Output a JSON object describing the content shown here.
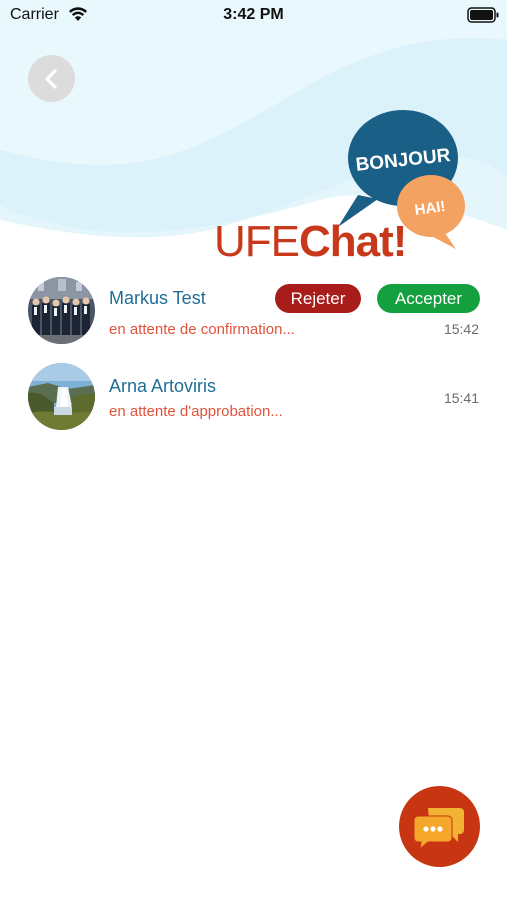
{
  "status_bar": {
    "carrier": "Carrier",
    "time": "3:42 PM"
  },
  "header": {
    "logo": {
      "prefix": "UFE",
      "suffix": "Chat!",
      "bubble_large": "BONJOUR",
      "bubble_small": "HAI!"
    }
  },
  "chats": [
    {
      "name": "Markus Test",
      "status": "en attente de confirmation...",
      "time": "15:42",
      "reject_label": "Rejeter",
      "accept_label": "Accepter"
    },
    {
      "name": "Arna Artoviris",
      "status": "en attente d'approbation...",
      "time": "15:41"
    }
  ],
  "colors": {
    "accent_red": "#c83512",
    "reject": "#a81d1a",
    "accept": "#14a03f",
    "name_blue": "#1f6e96",
    "status_orange": "#e0533b"
  },
  "icons": {
    "back": "chevron-left-icon",
    "fab": "chat-bubbles-icon",
    "wifi": "wifi-icon",
    "battery": "battery-icon"
  }
}
